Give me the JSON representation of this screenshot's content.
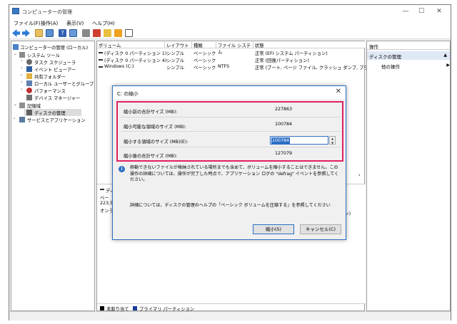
{
  "window": {
    "title": "コンピューターの管理",
    "controls": {
      "minimize": "—",
      "maximize": "☐",
      "close": "✕"
    }
  },
  "menu": [
    "ファイル(F)",
    "操作(A)",
    "表示(V)",
    "ヘルプ(H)"
  ],
  "tree": {
    "root": "コンピューターの管理 (ローカル)",
    "system_tools": "システム ツール",
    "task_scheduler": "タスク スケジューラ",
    "event_viewer": "イベント ビューアー",
    "shared_folders": "共有フォルダー",
    "local_users": "ローカル ユーザーとグループ",
    "performance": "パフォーマンス",
    "device_manager": "デバイス マネージャー",
    "storage": "記憶域",
    "disk_management": "ディスクの管理",
    "services": "サービスとアプリケーション"
  },
  "volumes": {
    "headers": [
      "ボリューム",
      "レイアウト",
      "種類",
      "ファイル システム",
      "状態"
    ],
    "rows": [
      {
        "volume": "(ディスク 0 パーティション 1)",
        "layout": "シンプル",
        "type": "ベーシック",
        "fs": "",
        "status": "正常 (EFI システム パーティション)"
      },
      {
        "volume": "(ディスク 0 パーティション 4)",
        "layout": "シンプル",
        "type": "ベーシック",
        "fs": "",
        "status": "正常 (回復パーティション)"
      },
      {
        "volume": "Windows (C:)",
        "layout": "シンプル",
        "type": "ベーシック",
        "fs": "NTFS",
        "status": "正常 (ブート, ページ ファイル, クラッシュ ダンプ, プラ"
      }
    ]
  },
  "disk_pane": {
    "line1": "ディ",
    "line2": "ベー",
    "line3": "223,5",
    "line4": "オンラ",
    "right_fragment": "ョン)"
  },
  "legend": {
    "unallocated": "未割り当て",
    "primary": "プライマリ パーティション"
  },
  "actions": {
    "header": "操作",
    "selected": "ディスクの管理",
    "other": "他の操作"
  },
  "dialog": {
    "title": "C: の縮小",
    "fields": [
      {
        "label": "縮小前の合計サイズ (MB):",
        "value": "227863"
      },
      {
        "label": "縮小可能な領域のサイズ (MB):",
        "value": "100784"
      },
      {
        "label": "縮小する領域のサイズ (MB)(E):",
        "value": "100784"
      },
      {
        "label": "縮小後の合計サイズ (MB):",
        "value": "127079"
      }
    ],
    "info": "移動できないファイルが格納されている場所までも含めて、ボリュームを縮小することはできません。この操作の詳細については、操作が完了した時点で、アプリケーション ログの \"defrag\" イベントを参照してください。",
    "detail": "詳細については、ディスクの管理のヘルプの「ベーシック ボリュームを圧縮する」を参照してください",
    "shrink_button": "縮小(S)",
    "cancel_button": "キャンセル(C)"
  },
  "colors": {
    "accent": "#2b6fc4",
    "highlight_box": "#e02060"
  }
}
